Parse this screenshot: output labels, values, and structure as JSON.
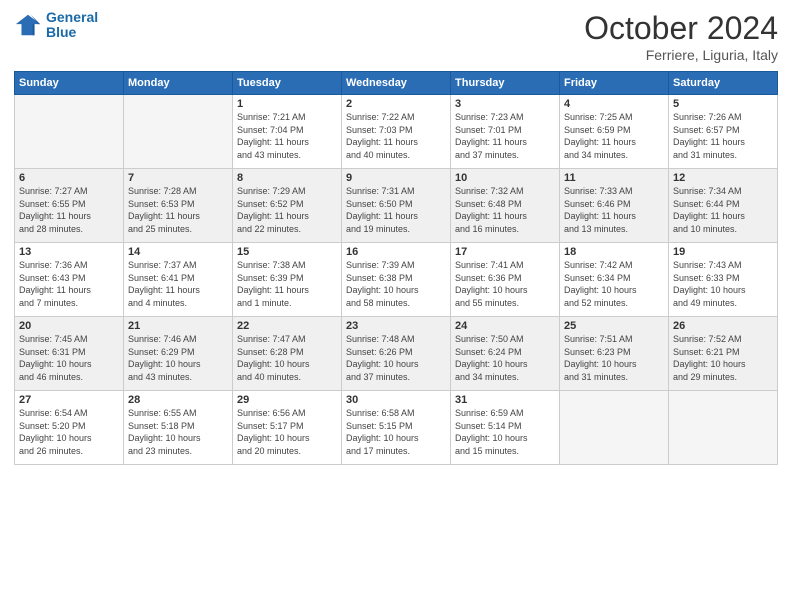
{
  "header": {
    "logo_line1": "General",
    "logo_line2": "Blue",
    "month_title": "October 2024",
    "location": "Ferriere, Liguria, Italy"
  },
  "days_of_week": [
    "Sunday",
    "Monday",
    "Tuesday",
    "Wednesday",
    "Thursday",
    "Friday",
    "Saturday"
  ],
  "weeks": [
    [
      {
        "num": "",
        "info": ""
      },
      {
        "num": "",
        "info": ""
      },
      {
        "num": "1",
        "info": "Sunrise: 7:21 AM\nSunset: 7:04 PM\nDaylight: 11 hours\nand 43 minutes."
      },
      {
        "num": "2",
        "info": "Sunrise: 7:22 AM\nSunset: 7:03 PM\nDaylight: 11 hours\nand 40 minutes."
      },
      {
        "num": "3",
        "info": "Sunrise: 7:23 AM\nSunset: 7:01 PM\nDaylight: 11 hours\nand 37 minutes."
      },
      {
        "num": "4",
        "info": "Sunrise: 7:25 AM\nSunset: 6:59 PM\nDaylight: 11 hours\nand 34 minutes."
      },
      {
        "num": "5",
        "info": "Sunrise: 7:26 AM\nSunset: 6:57 PM\nDaylight: 11 hours\nand 31 minutes."
      }
    ],
    [
      {
        "num": "6",
        "info": "Sunrise: 7:27 AM\nSunset: 6:55 PM\nDaylight: 11 hours\nand 28 minutes."
      },
      {
        "num": "7",
        "info": "Sunrise: 7:28 AM\nSunset: 6:53 PM\nDaylight: 11 hours\nand 25 minutes."
      },
      {
        "num": "8",
        "info": "Sunrise: 7:29 AM\nSunset: 6:52 PM\nDaylight: 11 hours\nand 22 minutes."
      },
      {
        "num": "9",
        "info": "Sunrise: 7:31 AM\nSunset: 6:50 PM\nDaylight: 11 hours\nand 19 minutes."
      },
      {
        "num": "10",
        "info": "Sunrise: 7:32 AM\nSunset: 6:48 PM\nDaylight: 11 hours\nand 16 minutes."
      },
      {
        "num": "11",
        "info": "Sunrise: 7:33 AM\nSunset: 6:46 PM\nDaylight: 11 hours\nand 13 minutes."
      },
      {
        "num": "12",
        "info": "Sunrise: 7:34 AM\nSunset: 6:44 PM\nDaylight: 11 hours\nand 10 minutes."
      }
    ],
    [
      {
        "num": "13",
        "info": "Sunrise: 7:36 AM\nSunset: 6:43 PM\nDaylight: 11 hours\nand 7 minutes."
      },
      {
        "num": "14",
        "info": "Sunrise: 7:37 AM\nSunset: 6:41 PM\nDaylight: 11 hours\nand 4 minutes."
      },
      {
        "num": "15",
        "info": "Sunrise: 7:38 AM\nSunset: 6:39 PM\nDaylight: 11 hours\nand 1 minute."
      },
      {
        "num": "16",
        "info": "Sunrise: 7:39 AM\nSunset: 6:38 PM\nDaylight: 10 hours\nand 58 minutes."
      },
      {
        "num": "17",
        "info": "Sunrise: 7:41 AM\nSunset: 6:36 PM\nDaylight: 10 hours\nand 55 minutes."
      },
      {
        "num": "18",
        "info": "Sunrise: 7:42 AM\nSunset: 6:34 PM\nDaylight: 10 hours\nand 52 minutes."
      },
      {
        "num": "19",
        "info": "Sunrise: 7:43 AM\nSunset: 6:33 PM\nDaylight: 10 hours\nand 49 minutes."
      }
    ],
    [
      {
        "num": "20",
        "info": "Sunrise: 7:45 AM\nSunset: 6:31 PM\nDaylight: 10 hours\nand 46 minutes."
      },
      {
        "num": "21",
        "info": "Sunrise: 7:46 AM\nSunset: 6:29 PM\nDaylight: 10 hours\nand 43 minutes."
      },
      {
        "num": "22",
        "info": "Sunrise: 7:47 AM\nSunset: 6:28 PM\nDaylight: 10 hours\nand 40 minutes."
      },
      {
        "num": "23",
        "info": "Sunrise: 7:48 AM\nSunset: 6:26 PM\nDaylight: 10 hours\nand 37 minutes."
      },
      {
        "num": "24",
        "info": "Sunrise: 7:50 AM\nSunset: 6:24 PM\nDaylight: 10 hours\nand 34 minutes."
      },
      {
        "num": "25",
        "info": "Sunrise: 7:51 AM\nSunset: 6:23 PM\nDaylight: 10 hours\nand 31 minutes."
      },
      {
        "num": "26",
        "info": "Sunrise: 7:52 AM\nSunset: 6:21 PM\nDaylight: 10 hours\nand 29 minutes."
      }
    ],
    [
      {
        "num": "27",
        "info": "Sunrise: 6:54 AM\nSunset: 5:20 PM\nDaylight: 10 hours\nand 26 minutes."
      },
      {
        "num": "28",
        "info": "Sunrise: 6:55 AM\nSunset: 5:18 PM\nDaylight: 10 hours\nand 23 minutes."
      },
      {
        "num": "29",
        "info": "Sunrise: 6:56 AM\nSunset: 5:17 PM\nDaylight: 10 hours\nand 20 minutes."
      },
      {
        "num": "30",
        "info": "Sunrise: 6:58 AM\nSunset: 5:15 PM\nDaylight: 10 hours\nand 17 minutes."
      },
      {
        "num": "31",
        "info": "Sunrise: 6:59 AM\nSunset: 5:14 PM\nDaylight: 10 hours\nand 15 minutes."
      },
      {
        "num": "",
        "info": ""
      },
      {
        "num": "",
        "info": ""
      }
    ]
  ]
}
